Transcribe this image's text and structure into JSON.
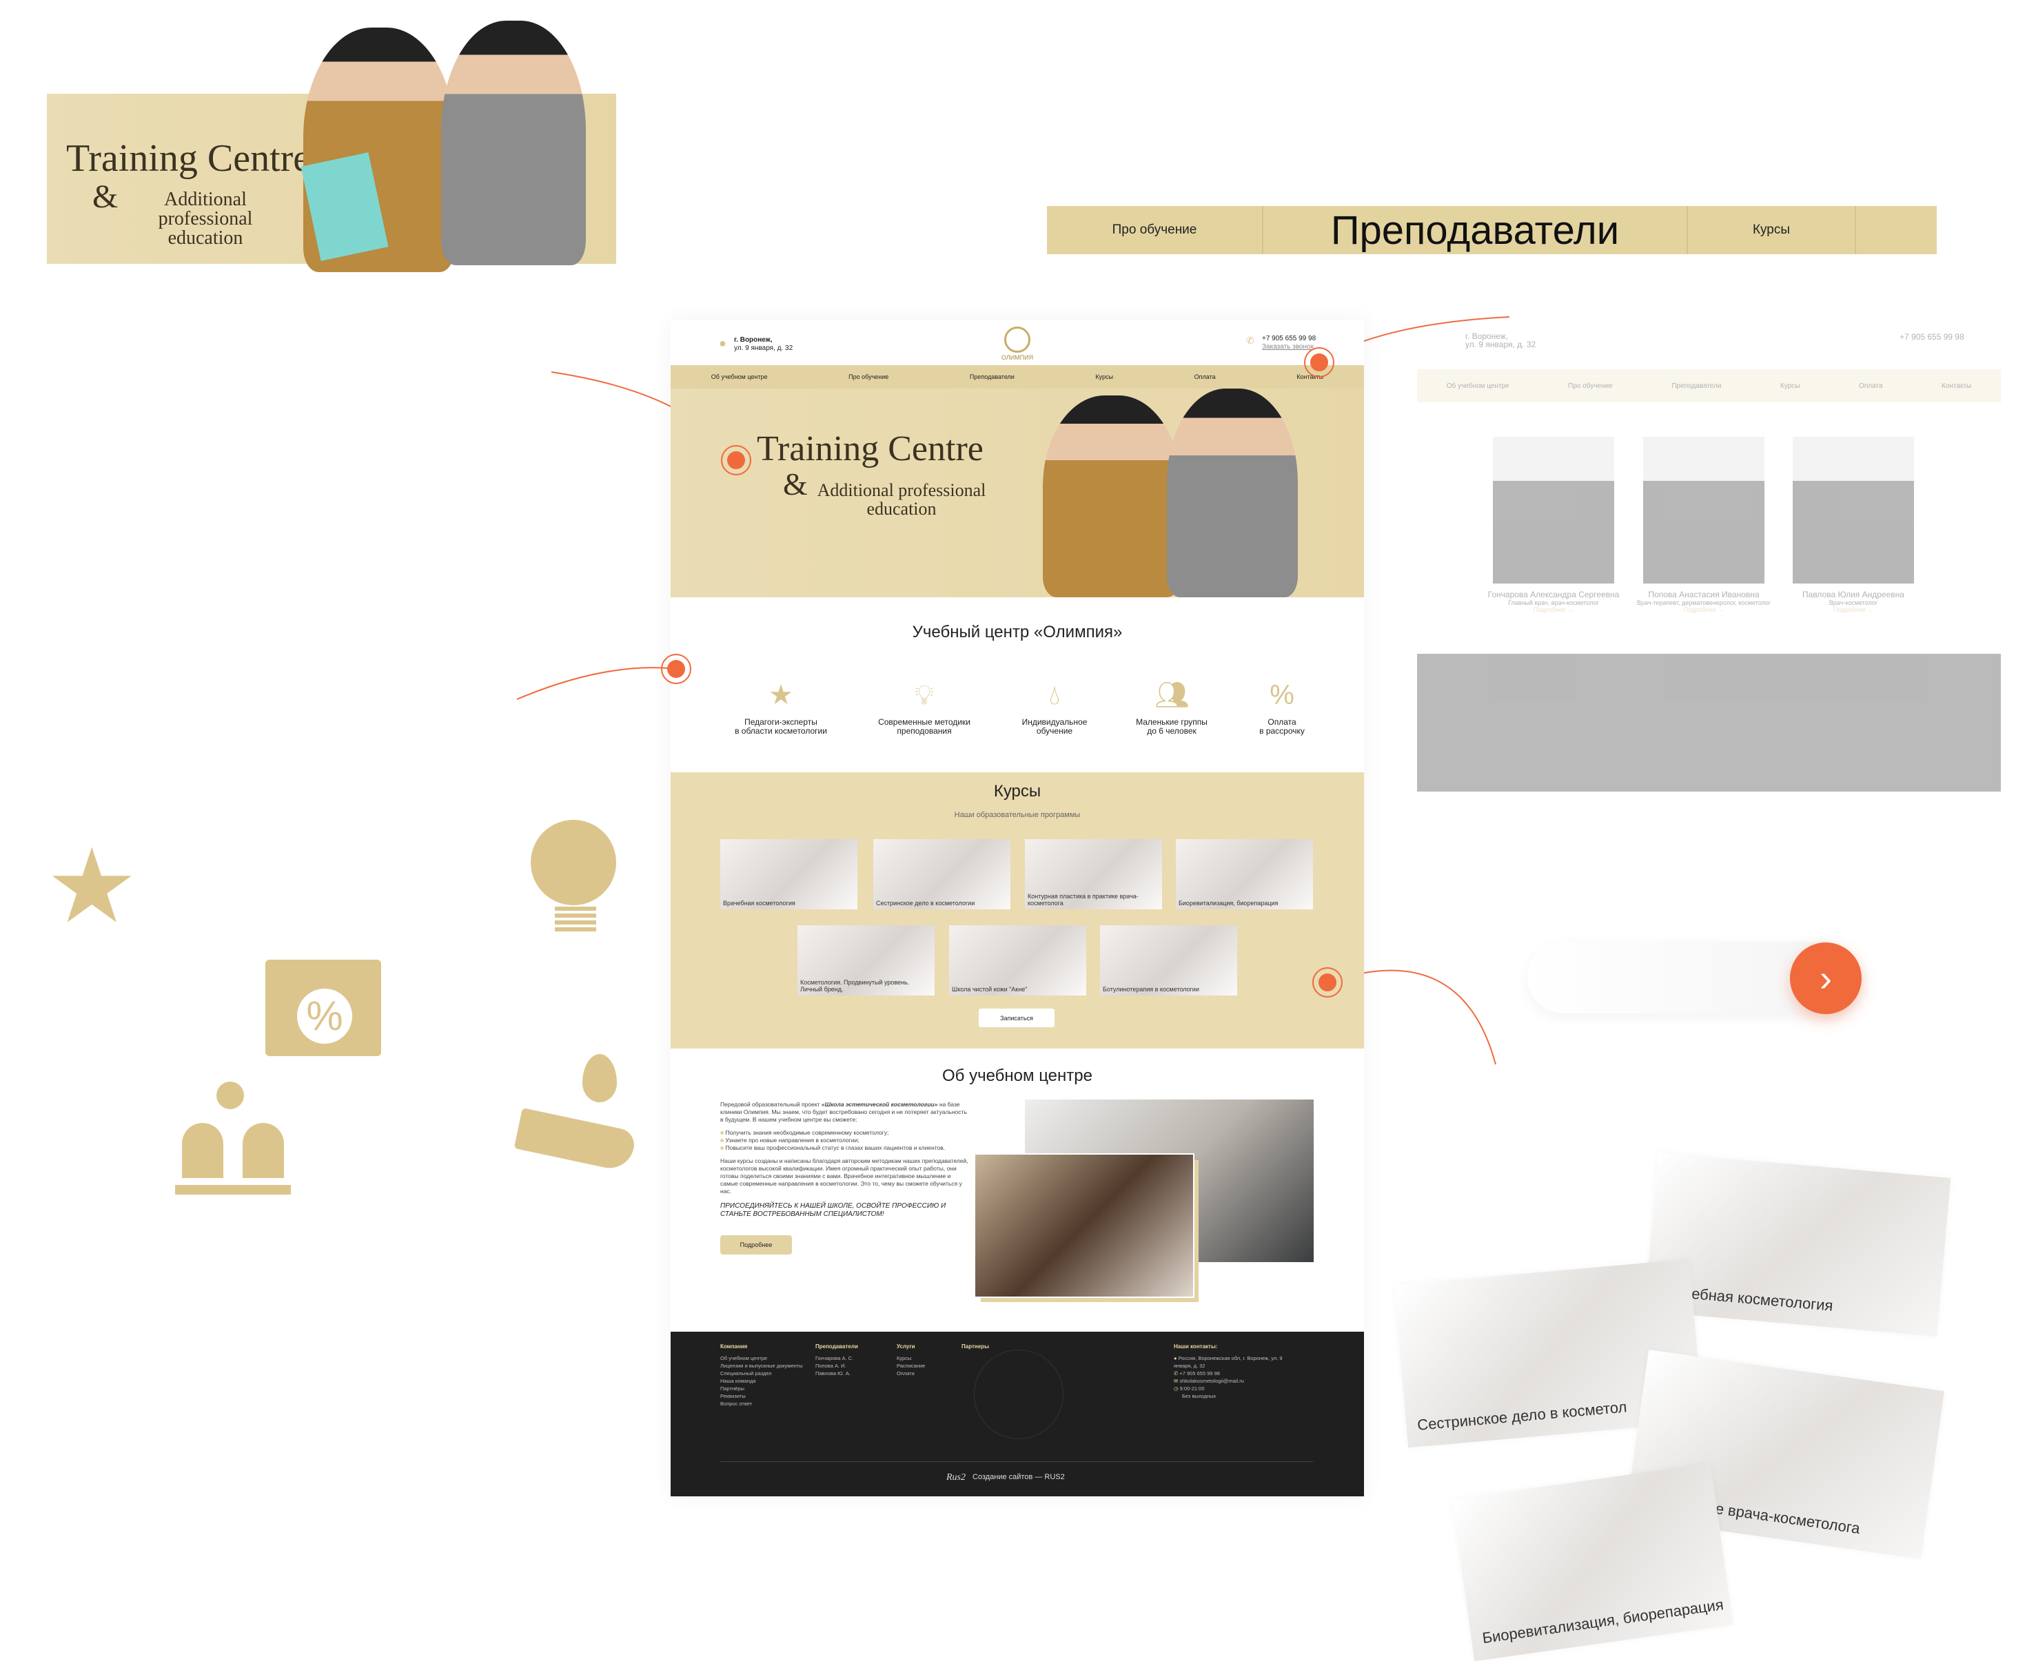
{
  "banner": {
    "title": "Training Centre",
    "amp": "&",
    "subtitle_1": "Additional professional",
    "subtitle_2": "education"
  },
  "nav_strip": {
    "items": [
      "Про обучение",
      "Преподаватели",
      "Курсы"
    ],
    "active": "Преподаватели"
  },
  "site": {
    "city": "г. Воронеж,",
    "address": "ул. 9 января, д. 32",
    "logo": "ОЛИМПИЯ",
    "phone": "+7 905 655 99 98",
    "callback": "Заказать звонок",
    "menu": [
      "Об учебном центре",
      "Про обучение",
      "Преподаватели",
      "Курсы",
      "Оплата",
      "Контакты"
    ],
    "hero": {
      "title": "Training Centre",
      "amp": "&",
      "subtitle_1": "Additional professional",
      "subtitle_2": "education"
    },
    "section_title": "Учебный центр «Олимпия»",
    "features": [
      {
        "icon": "experts-stars-icon",
        "l1": "Педагоги-эксперты",
        "l2": "в области косметологии"
      },
      {
        "icon": "lightbulb-icon",
        "l1": "Современные методики",
        "l2": "преподования"
      },
      {
        "icon": "hand-drop-icon",
        "l1": "Индивидуальное",
        "l2": "обучение"
      },
      {
        "icon": "small-group-icon",
        "l1": "Маленькие группы",
        "l2": "до 6 человек"
      },
      {
        "icon": "calendar-percent-icon",
        "l1": "Оплата",
        "l2": "в рассрочку"
      }
    ],
    "courses": {
      "title": "Курсы",
      "subtitle": "Наши образовательные программы",
      "button": "Записаться",
      "items": [
        "Врачебная косметология",
        "Сестринское дело в косметологии",
        "Контурная пластика в практике врача-косметолога",
        "Биоревитализация, биорепарация",
        "Косметология. Продвинутый уровень. Личный бренд.",
        "Школа чистой кожи \"Акне\"",
        "Ботулинотерапия в косметологии"
      ]
    },
    "about": {
      "title": "Об учебном центре",
      "p1_a": "Передовой образовательный проект ",
      "p1_b": "«Школа эстетической косметологии»",
      "p1_c": " на базе клиники Олимпия. Мы знаем, что будет востребовано сегодня и не потеряет актуальность в будущем. В нашем учебном центре вы сможете:",
      "bullets": [
        "Получить знания необходимые современному косметологу;",
        "Узнаете про новые направления в косметологии;",
        "Повысите ваш профессиональный статус в глазах ваших пациентов и клиентов."
      ],
      "p2": "Наши курсы созданы и написаны благодаря авторским методикам наших преподавателей, косметологов высокой квалификации. Имея огромный практический опыт работы, они готовы поделиться своими знаниями с вами. Врачебное интегративное мышление и самые современные направления в косметологии. Это то, чему вы сможете обучиться у нас.",
      "cta": "ПРИСОЕДИНЯЙТЕСЬ К НАШЕЙ ШКОЛЕ, ОСВОЙТЕ ПРОФЕССИЮ И СТАНЬТЕ ВОСТРЕБОВАННЫМ СПЕЦИАЛИСТОМ!",
      "button": "Подробнее"
    },
    "footer": {
      "company": {
        "title": "Компания",
        "items": [
          "Об учебном центре",
          "Лицензии и выпускные документы",
          "Специальный раздел",
          "Наша команда",
          "Партнёры",
          "Реквизиты",
          "Вопрос ответ"
        ]
      },
      "teachers": {
        "title": "Преподаватели",
        "items": [
          "Гончарова А. С.",
          "Попова А. И.",
          "Павлова Ю. А."
        ]
      },
      "services": {
        "title": "Услуги",
        "items": [
          "Курсы",
          "Расписание",
          "Оплата"
        ]
      },
      "partners": {
        "title": "Партнеры"
      },
      "contacts": {
        "title": "Наши контакты:",
        "address": "Россия, Воронежская обл, г. Воронеж, ул. 9 января, д. 32",
        "phone": "+7 905 655 99 98",
        "email": "shkolakosmetologii@mail.ru",
        "hours": "9:00-21:00",
        "days": "Без выходных"
      },
      "credit_logo": "Rus2",
      "credit": "Создание сайтов — RUS2"
    }
  },
  "teachers_page": {
    "teachers": [
      {
        "name": "Гончарова Александра Сергеевна",
        "role": "Главный врач, врач-косметолог",
        "more": "Подробнее →"
      },
      {
        "name": "Попова Анастасия Ивановна",
        "role": "Врач-терапевт, дерматовенеролог, косметолог",
        "more": "Подробнее →"
      },
      {
        "name": "Павлова Юлия Андреевна",
        "role": "Врач-косметолог",
        "more": "Подробнее →"
      }
    ]
  },
  "scattered_cards": [
    "Врачебная косметология",
    "Сестринское дело в косметол",
    "Контурная пластика в практике врача-косметолога",
    "Биоревитализация, биорепарация"
  ],
  "colors": {
    "beige": "#e9dbb0",
    "accent": "#f06a3c",
    "footer": "#1f1f1f",
    "icon_gold": "#dcc58c"
  }
}
